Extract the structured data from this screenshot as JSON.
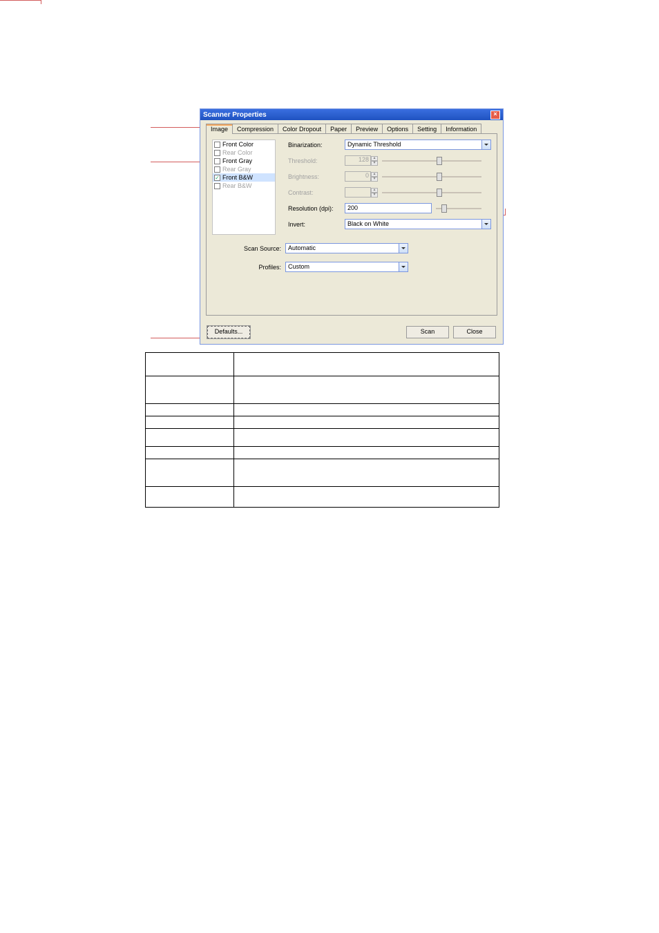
{
  "dialog": {
    "title": "Scanner Properties",
    "tabs": [
      "Image",
      "Compression",
      "Color Dropout",
      "Paper",
      "Preview",
      "Options",
      "Setting",
      "Information"
    ],
    "image_selection": [
      {
        "label": "Front Color",
        "checked": false,
        "greyed": false
      },
      {
        "label": "Rear Color",
        "checked": false,
        "greyed": true
      },
      {
        "label": "Front Gray",
        "checked": false,
        "greyed": false
      },
      {
        "label": "Rear Gray",
        "checked": false,
        "greyed": true
      },
      {
        "label": "Front B&W",
        "checked": true,
        "greyed": false,
        "selected": true
      },
      {
        "label": "Rear B&W",
        "checked": false,
        "greyed": true
      }
    ],
    "settings": {
      "binarization": {
        "label": "Binarization:",
        "value": "Dynamic Threshold"
      },
      "threshold": {
        "label": "Threshold:",
        "value": "128"
      },
      "brightness": {
        "label": "Brightness:",
        "value": "0"
      },
      "contrast": {
        "label": "Contrast:",
        "value": ""
      },
      "resolution": {
        "label": "Resolution (dpi):",
        "value": "200"
      },
      "invert": {
        "label": "Invert:",
        "value": "Black on White"
      }
    },
    "scan_source": {
      "label": "Scan Source:",
      "value": "Automatic"
    },
    "profiles": {
      "label": "Profiles:",
      "value": "Custom"
    },
    "buttons": {
      "defaults": "Defaults...",
      "scan": "Scan",
      "close": "Close"
    }
  }
}
